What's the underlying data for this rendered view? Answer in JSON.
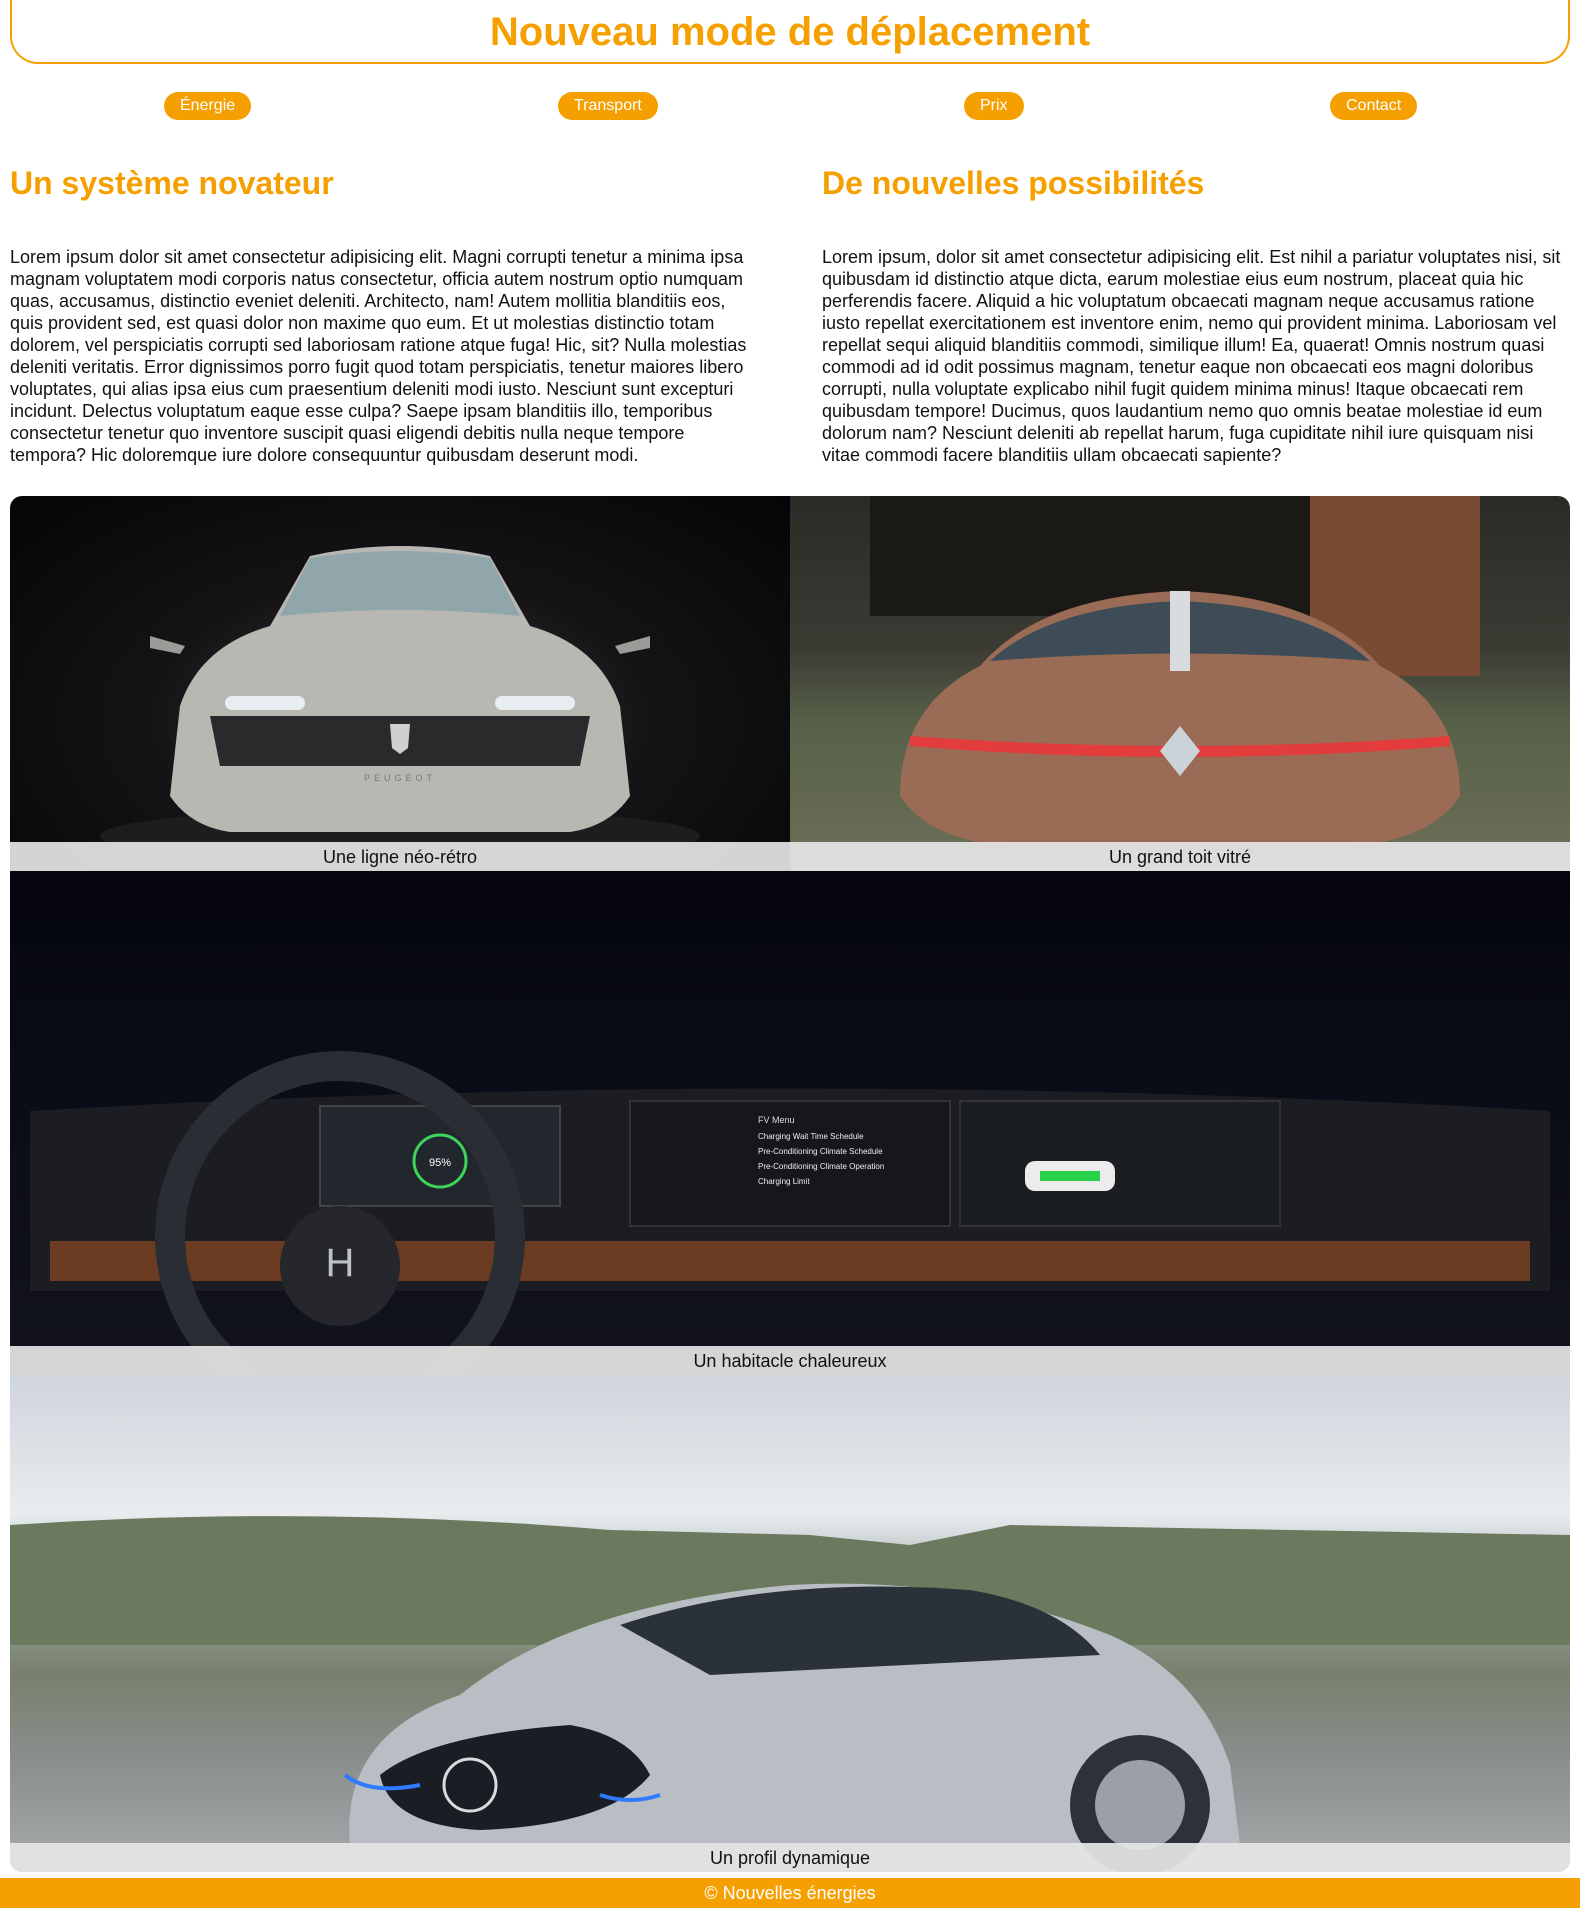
{
  "header": {
    "title": "Nouveau mode de déplacement"
  },
  "nav": {
    "items": [
      "Énergie",
      "Transport",
      "Prix",
      "Contact"
    ]
  },
  "columns": [
    {
      "title": "Un système novateur",
      "text": "Lorem ipsum dolor sit amet consectetur adipisicing elit. Magni corrupti tenetur a minima ipsa magnam voluptatem modi corporis natus consectetur, officia autem nostrum optio numquam quas, accusamus, distinctio eveniet deleniti. Architecto, nam! Autem mollitia blanditiis eos, quis provident sed, est quasi dolor non maxime quo eum. Et ut molestias distinctio totam dolorem, vel perspiciatis corrupti sed laboriosam ratione atque fuga! Hic, sit? Nulla molestias deleniti veritatis. Error dignissimos porro fugit quod totam perspiciatis, tenetur maiores libero voluptates, qui alias ipsa eius cum praesentium deleniti modi iusto. Nesciunt sunt excepturi incidunt. Delectus voluptatum eaque esse culpa? Saepe ipsam blanditiis illo, temporibus consectetur tenetur quo inventore suscipit quasi eligendi debitis nulla neque tempore tempora? Hic doloremque iure dolore consequuntur quibusdam deserunt modi."
    },
    {
      "title": "De nouvelles possibilités",
      "text": "Lorem ipsum, dolor sit amet consectetur adipisicing elit. Est nihil a pariatur voluptates nisi, sit quibusdam id distinctio atque dicta, earum molestiae eius eum nostrum, placeat quia hic perferendis facere. Aliquid a hic voluptatum obcaecati magnam neque accusamus ratione iusto repellat exercitationem est inventore enim, nemo qui provident minima. Laboriosam vel repellat sequi aliquid blanditiis commodi, similique illum! Ea, quaerat! Omnis nostrum quasi commodi ad id odit possimus magnam, tenetur eaque non obcaecati eos magni doloribus corrupti, nulla voluptate explicabo nihil fugit quidem minima minus! Itaque obcaecati rem quibusdam tempore! Ducimus, quos laudantium nemo quo omnis beatae molestiae id eum dolorum nam? Nesciunt deleniti ab repellat harum, fuga cupiditate nihil iure quisquam nisi vitae commodi facere blanditiis ullam obcaecati sapiente?"
    }
  ],
  "gallery": {
    "captions": [
      "Une ligne néo-rétro",
      "Un grand toit vitré",
      "Un habitacle chaleureux",
      "Un profil dynamique"
    ],
    "image_text": {
      "peugeot_badge": "PEUGEOT",
      "fv_menu": "FV Menu",
      "menu_items": [
        "Charging Wait Time Schedule",
        "Pre-Conditioning Climate Schedule",
        "Pre-Conditioning Climate Operation",
        "Charging Limit"
      ],
      "battery_level": "95%"
    }
  },
  "footer": {
    "text": "© Nouvelles énergies"
  },
  "colors": {
    "accent": "#f5a000",
    "text": "#111111",
    "caption_bg": "#e6e6e6"
  }
}
